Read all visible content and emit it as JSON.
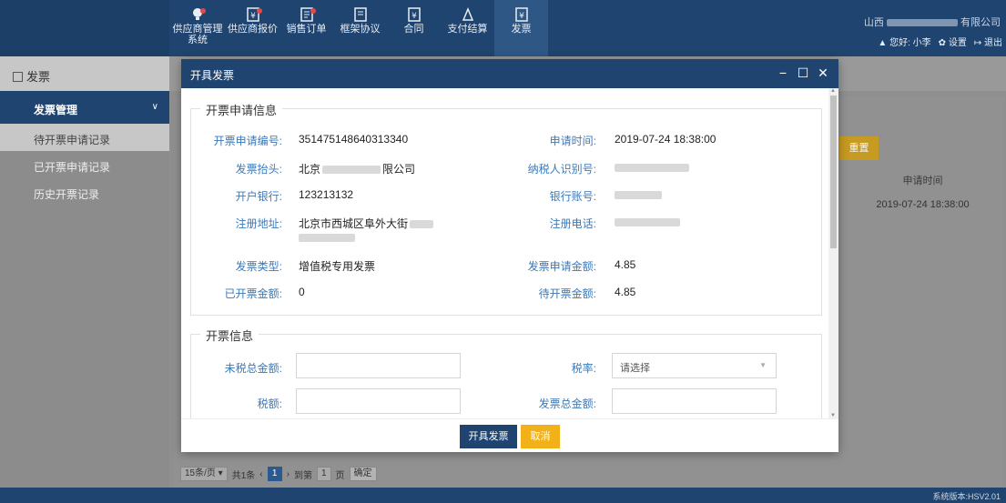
{
  "nav": {
    "items": [
      {
        "label": "供应商管理系统",
        "icon": "lightbulb-icon",
        "badge": true
      },
      {
        "label": "供应商报价",
        "icon": "yen-doc-icon",
        "badge": true
      },
      {
        "label": "销售订单",
        "icon": "order-icon",
        "badge": true
      },
      {
        "label": "框架协议",
        "icon": "agreement-icon",
        "badge": false
      },
      {
        "label": "合同",
        "icon": "contract-icon",
        "badge": false
      },
      {
        "label": "支付结算",
        "icon": "payment-icon",
        "badge": false
      },
      {
        "label": "发票",
        "icon": "invoice-icon",
        "badge": false
      }
    ]
  },
  "user": {
    "company_prefix": "山西",
    "company_suffix": "有限公司",
    "greeting": "您好: 小李",
    "settings": "设置",
    "logout": "退出"
  },
  "sidebar": {
    "title": "发票",
    "group": "发票管理",
    "items": [
      "待开票申请记录",
      "已开票申请记录",
      "历史开票记录"
    ]
  },
  "background": {
    "reset_label": "重置",
    "column_header": "申请时间",
    "cell_time": "2019-07-24 18:38:00",
    "pager": {
      "page_size": "15条/页",
      "total": "共1条",
      "current_page": "1",
      "goto_label": "到第",
      "goto_value": "1",
      "page_unit": "页",
      "confirm": "确定"
    },
    "version": "系统版本:HSV2.01"
  },
  "dialog": {
    "title": "开具发票",
    "section1": {
      "legend": "开票申请信息",
      "apply_no_label": "开票申请编号:",
      "apply_no": "351475148640313340",
      "apply_time_label": "申请时间:",
      "apply_time": "2019-07-24 18:38:00",
      "header_label": "发票抬头:",
      "header_prefix": "北京",
      "header_suffix": "限公司",
      "taxid_label": "纳税人识别号:",
      "bank_label": "开户银行:",
      "bank": "123213132",
      "account_label": "银行账号:",
      "address_label": "注册地址:",
      "address": "北京市西城区阜外大街",
      "phone_label": "注册电话:",
      "type_label": "发票类型:",
      "type": "增值税专用发票",
      "apply_amount_label": "发票申请金额:",
      "apply_amount": "4.85",
      "issued_label": "已开票金额:",
      "issued": "0",
      "pending_label": "待开票金额:",
      "pending": "4.85"
    },
    "section2": {
      "legend": "开票信息",
      "pretax_label": "未税总金额:",
      "rate_label": "税率:",
      "rate_placeholder": "请选择",
      "tax_label": "税额:",
      "total_label": "发票总金额:"
    },
    "confirm_label": "开具发票",
    "cancel_label": "取消"
  }
}
